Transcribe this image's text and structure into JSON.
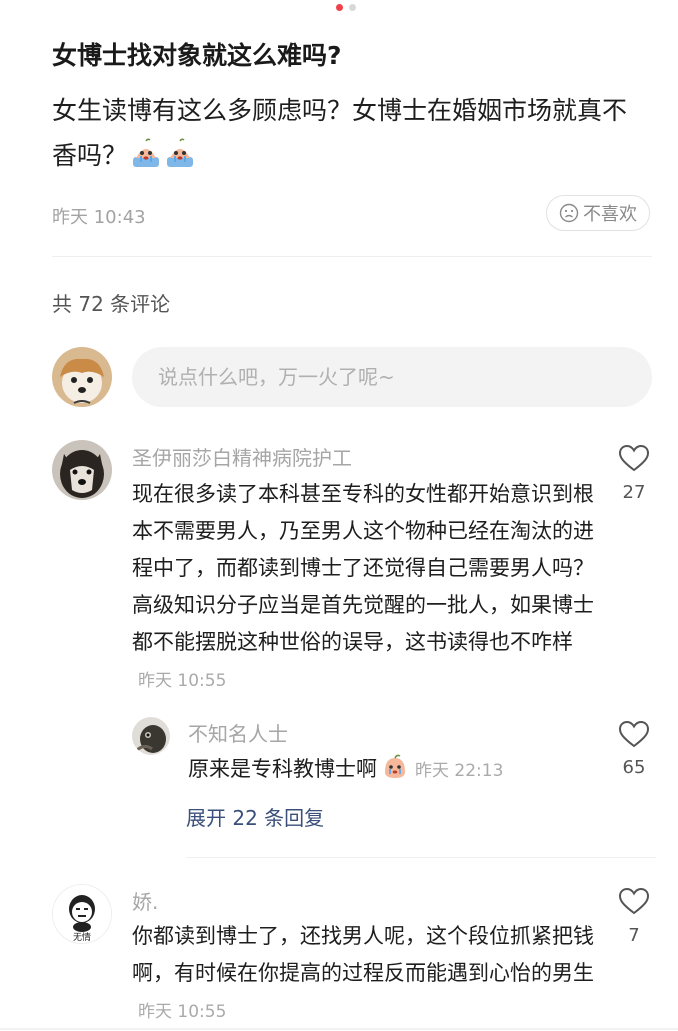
{
  "post": {
    "title": "女博士找对象就这么难吗?",
    "body": "女生读博有这么多顾虑吗？女博士在婚姻市场就真不香吗？",
    "time": "昨天 10:43",
    "dislike_label": "不喜欢"
  },
  "comments_header": {
    "count_text": "共 72 条评论"
  },
  "input": {
    "placeholder": "说点什么吧，万一火了呢~"
  },
  "comments": [
    {
      "user": "圣伊丽莎白精神病院护工",
      "text": "现在很多读了本科甚至专科的女性都开始意识到根本不需要男人，乃至男人这个物种已经在淘汰的进程中了，而都读到博士了还觉得自己需要男人吗？高级知识分子应当是首先觉醒的一批人，如果博士都不能摆脱这种世俗的误导，这书读得也不咋样",
      "time": "昨天 10:55",
      "likes": "27",
      "reply": {
        "user": "不知名人士",
        "text": "原来是专科教博士啊",
        "time": "昨天 22:13",
        "likes": "65"
      },
      "expand_label": "展开 22 条回复"
    },
    {
      "user": "娇.",
      "text": "你都读到博士了，还找男人呢，这个段位抓紧把钱啊，有时候在你提高的过程反而能遇到心怡的男生",
      "time": "昨天 10:55",
      "likes": "7",
      "avatar_caption": "无情"
    }
  ],
  "colors": {
    "accent": "#f0404a",
    "link": "#3a4f7a",
    "muted": "#a6a6a6"
  },
  "icons": [
    "crying-emoji-icon",
    "frown-icon",
    "heart-outline-icon"
  ]
}
